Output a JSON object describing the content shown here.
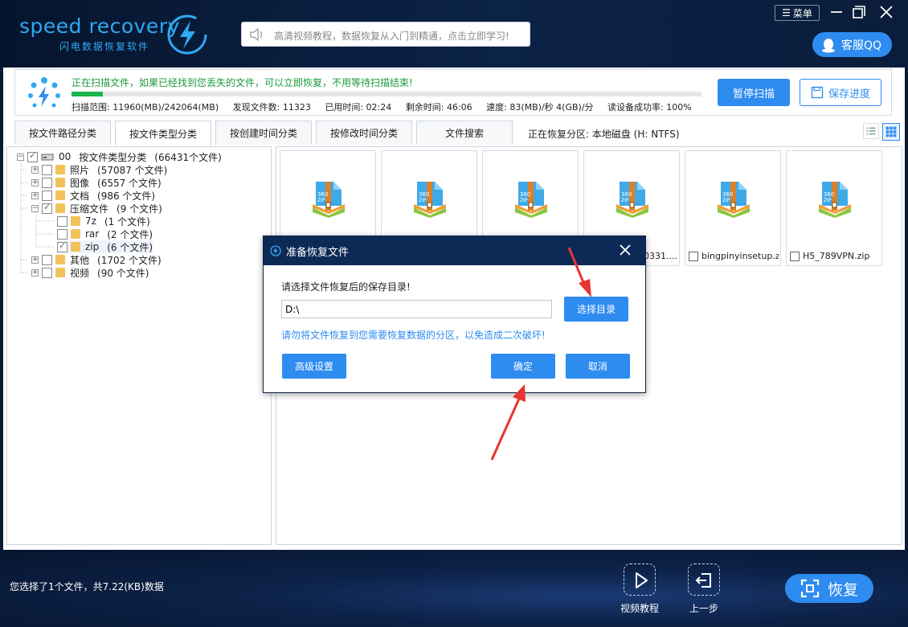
{
  "header": {
    "logo_main": "speed recovery",
    "logo_sub": "闪电数据恢复软件",
    "tip": "高清视频教程，数据恢复从入门到精通，点击立即学习!",
    "menu_label": "菜单",
    "qq_label": "客服QQ"
  },
  "scan": {
    "status": "正在扫描文件，如果已经找到您丢失的文件，可以立即恢复，不用等待扫描结束!",
    "progress": 0.05,
    "range": "扫描范围: 11960(MB)/242064(MB)",
    "found": "发现文件数: 11323",
    "elapsed": "已用时间: 02:24",
    "remaining": "剩余时间: 46:06",
    "speed": "速度: 83(MB)/秒  4(GB)/分",
    "success": "读设备成功率: 100%",
    "pause_label": "暂停扫描",
    "save_label": "保存进度"
  },
  "tabs": [
    {
      "label": "按文件路径分类",
      "active": false
    },
    {
      "label": "按文件类型分类",
      "active": true
    },
    {
      "label": "按创建时间分类",
      "active": false
    },
    {
      "label": "按修改时间分类",
      "active": false
    },
    {
      "label": "文件搜索",
      "active": false
    }
  ],
  "partition": "正在恢复分区: 本地磁盘 (H: NTFS)",
  "tree": {
    "root": {
      "prefix": "00",
      "label": "按文件类型分类",
      "count": "(66431个文件)"
    },
    "items": [
      {
        "label": "照片",
        "count": "(57087 个文件)"
      },
      {
        "label": "图像",
        "count": "(6557 个文件)"
      },
      {
        "label": "文档",
        "count": "(986 个文件)"
      },
      {
        "label": "压缩文件",
        "count": "(9 个文件)"
      },
      {
        "label": "7z",
        "count": "(1 个文件)"
      },
      {
        "label": "rar",
        "count": "(2 个文件)"
      },
      {
        "label": "zip",
        "count": "(6 个文件)"
      },
      {
        "label": "其他",
        "count": "(1702 个文件)"
      },
      {
        "label": "视频",
        "count": "(90 个文件)"
      }
    ]
  },
  "files": [
    {
      "name": ""
    },
    {
      "name": ""
    },
    {
      "name": ""
    },
    {
      "name": "0331...."
    },
    {
      "name": "bingpinyinsetup.zip"
    },
    {
      "name": "H5_789VPN.zip"
    }
  ],
  "dialog": {
    "title": "准备恢复文件",
    "prompt": "请选择文件恢复后的保存目录!",
    "path_value": "D:\\",
    "choose_label": "选择目录",
    "warning": "请勿将文件恢复到您需要恢复数据的分区，以免造成二次破坏!",
    "advanced_label": "高级设置",
    "ok_label": "确定",
    "cancel_label": "取消"
  },
  "footer": {
    "status": "您选择了1个文件，共7.22(KB)数据",
    "video_label": "视频教程",
    "prev_label": "上一步",
    "recover_label": "恢复"
  },
  "colors": {
    "accent": "#2e8cf0",
    "header_bg": "#0b2347",
    "scan_text": "#1a9a3c",
    "annotation": "#e8352f"
  }
}
